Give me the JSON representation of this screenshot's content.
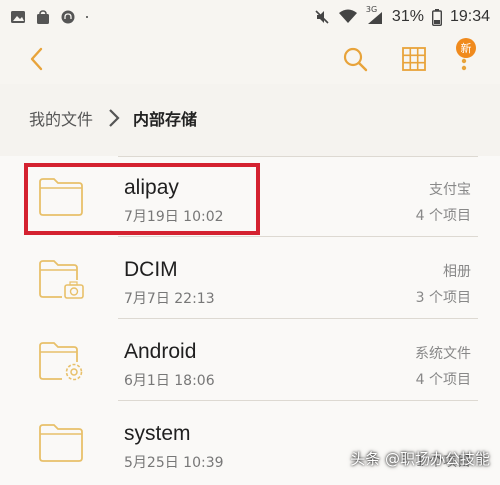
{
  "status_bar": {
    "battery_percent": "31%",
    "time": "19:34",
    "network": "3G",
    "icons": [
      "gallery-icon",
      "shopping-bag-icon",
      "headset-icon",
      "notification-dot-icon",
      "mute-icon",
      "wifi-icon",
      "signal-icon",
      "battery-icon"
    ]
  },
  "app_bar": {
    "badge": "新",
    "icons": [
      "back-icon",
      "search-icon",
      "grid-view-icon",
      "more-icon"
    ]
  },
  "breadcrumb": {
    "root": "我的文件",
    "current": "内部存储"
  },
  "files": [
    {
      "name": "alipay",
      "date": "7月19日 10:02",
      "type": "支付宝",
      "count": "4 个项目",
      "icon": "folder-icon"
    },
    {
      "name": "DCIM",
      "date": "7月7日 22:13",
      "type": "相册",
      "count": "3 个项目",
      "icon": "camera-folder-icon"
    },
    {
      "name": "Android",
      "date": "6月1日 18:06",
      "type": "系统文件",
      "count": "4 个项目",
      "icon": "settings-folder-icon"
    },
    {
      "name": "system",
      "date": "5月25日 10:39",
      "type": "",
      "count": "1 个项目",
      "icon": "folder-icon"
    }
  ],
  "colors": {
    "accent": "#e8a33a",
    "highlight": "#d42230",
    "badge": "#f08a1d"
  },
  "watermark": "头条 @职场办公技能"
}
